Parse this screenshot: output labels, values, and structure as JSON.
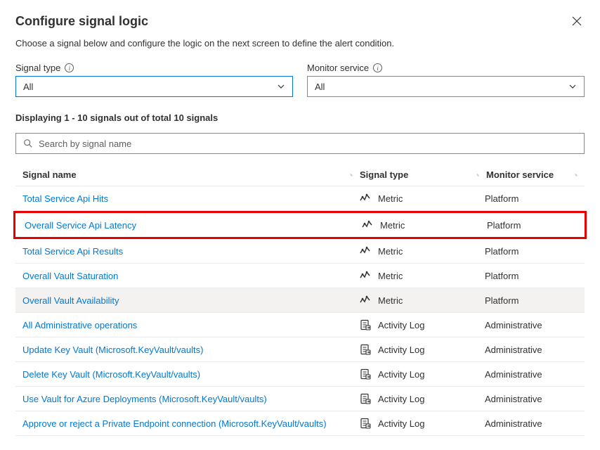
{
  "header": {
    "title": "Configure signal logic"
  },
  "description": "Choose a signal below and configure the logic on the next screen to define the alert condition.",
  "filters": {
    "signalType": {
      "label": "Signal type",
      "value": "All"
    },
    "monitorService": {
      "label": "Monitor service",
      "value": "All"
    }
  },
  "countText": "Displaying 1 - 10 signals out of total 10 signals",
  "search": {
    "placeholder": "Search by signal name"
  },
  "columns": {
    "signalName": "Signal name",
    "signalType": "Signal type",
    "monitorService": "Monitor service"
  },
  "rows": [
    {
      "name": "Total Service Api Hits",
      "type": "Metric",
      "monitor": "Platform",
      "icon": "metric",
      "highlighted": false,
      "hover": false
    },
    {
      "name": "Overall Service Api Latency",
      "type": "Metric",
      "monitor": "Platform",
      "icon": "metric",
      "highlighted": true,
      "hover": false
    },
    {
      "name": "Total Service Api Results",
      "type": "Metric",
      "monitor": "Platform",
      "icon": "metric",
      "highlighted": false,
      "hover": false
    },
    {
      "name": "Overall Vault Saturation",
      "type": "Metric",
      "monitor": "Platform",
      "icon": "metric",
      "highlighted": false,
      "hover": false
    },
    {
      "name": "Overall Vault Availability",
      "type": "Metric",
      "monitor": "Platform",
      "icon": "metric",
      "highlighted": false,
      "hover": true
    },
    {
      "name": "All Administrative operations",
      "type": "Activity Log",
      "monitor": "Administrative",
      "icon": "activity",
      "highlighted": false,
      "hover": false
    },
    {
      "name": "Update Key Vault (Microsoft.KeyVault/vaults)",
      "type": "Activity Log",
      "monitor": "Administrative",
      "icon": "activity",
      "highlighted": false,
      "hover": false
    },
    {
      "name": "Delete Key Vault (Microsoft.KeyVault/vaults)",
      "type": "Activity Log",
      "monitor": "Administrative",
      "icon": "activity",
      "highlighted": false,
      "hover": false
    },
    {
      "name": "Use Vault for Azure Deployments (Microsoft.KeyVault/vaults)",
      "type": "Activity Log",
      "monitor": "Administrative",
      "icon": "activity",
      "highlighted": false,
      "hover": false
    },
    {
      "name": "Approve or reject a Private Endpoint connection (Microsoft.KeyVault/vaults)",
      "type": "Activity Log",
      "monitor": "Administrative",
      "icon": "activity",
      "highlighted": false,
      "hover": false
    }
  ]
}
